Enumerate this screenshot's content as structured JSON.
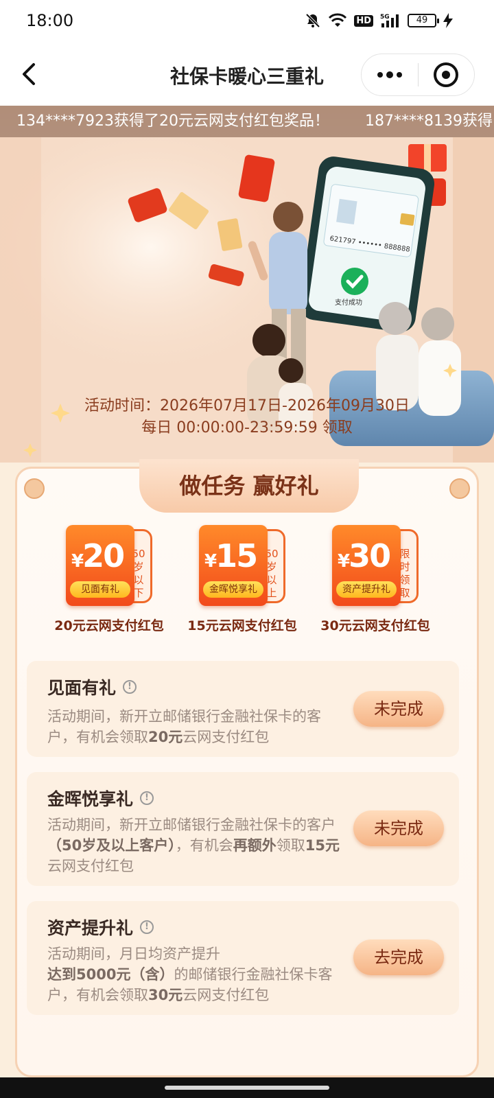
{
  "status": {
    "time": "18:00",
    "network": "HD",
    "signal": "5G",
    "battery": "49",
    "icons": [
      "bell-off-icon",
      "wifi-icon",
      "signal-icon",
      "battery-icon",
      "charging-icon"
    ]
  },
  "nav": {
    "title": "社保卡暖心三重礼",
    "back_icon": "chevron-left-icon",
    "more_icon": "more-dots-icon",
    "close_icon": "miniapp-close-icon"
  },
  "ticker": {
    "items": [
      "134****7923获得了20元云网支付红包奖品！",
      "187****8139获得"
    ]
  },
  "hero": {
    "phone_status_text": "支付成功",
    "card_number_text": "621797 •••••• 888888",
    "activity_time": "活动时间：2026年07月17日-2026年09月30日",
    "daily_time": "每日 00:00:00-23:59:59 领取"
  },
  "card": {
    "header": "做任务 赢好礼",
    "rewards": [
      {
        "amount": "20",
        "currency": "¥",
        "pill": "见面有礼",
        "tag": [
          "50",
          "岁",
          "以",
          "下"
        ],
        "caption": "20元云网支付红包"
      },
      {
        "amount": "15",
        "currency": "¥",
        "pill": "金晖悦享礼",
        "tag": [
          "50",
          "岁",
          "以",
          "上"
        ],
        "caption": "15元云网支付红包"
      },
      {
        "amount": "30",
        "currency": "¥",
        "pill": "资产提升礼",
        "tag": [
          "限",
          "时",
          "领",
          "取"
        ],
        "caption": "30元云网支付红包"
      }
    ],
    "tasks": [
      {
        "title": "见面有礼",
        "desc_parts": [
          "活动期间，新开立邮储银行金融社保卡的客户，有机会领取",
          "20元",
          "云网支付红包"
        ],
        "button": "未完成"
      },
      {
        "title": "金晖悦享礼",
        "desc_parts": [
          "活动期间，新开立邮储银行金融社保卡的客户",
          "（50岁及以上客户）",
          "，有机会",
          "再额外",
          "领取",
          "15元",
          "云网支付红包"
        ],
        "button": "未完成"
      },
      {
        "title": "资产提升礼",
        "desc_parts": [
          "活动期间，月日均资产提升",
          "达到5000元（含）",
          "的邮储银行金融社保卡客户，有机会领取",
          "30元",
          "云网支付红包"
        ],
        "button": "去完成"
      }
    ]
  },
  "colors": {
    "accent": "#f24a1b",
    "button_text": "#7a2a12",
    "page_bg": "#fbeedd"
  }
}
